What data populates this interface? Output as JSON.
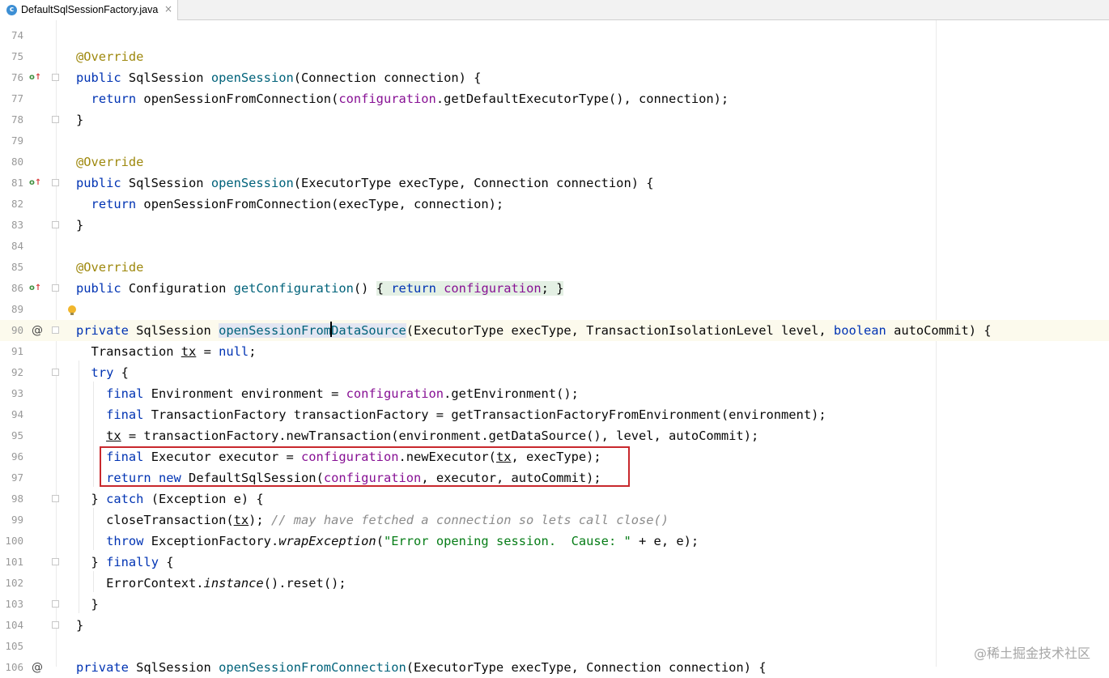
{
  "tab": {
    "icon_letter": "c",
    "title": "DefaultSqlSessionFactory.java",
    "close": "×"
  },
  "gutter": {
    "line_numbers": [
      "74",
      "75",
      "76",
      "77",
      "78",
      "79",
      "80",
      "81",
      "82",
      "83",
      "84",
      "85",
      "86",
      "89",
      "90",
      "91",
      "92",
      "93",
      "94",
      "95",
      "96",
      "97",
      "98",
      "99",
      "100",
      "101",
      "102",
      "103",
      "104",
      "105",
      "106"
    ],
    "override_icon": "o",
    "up_arrow": "↑",
    "at_marker": "@"
  },
  "code": {
    "l75": "@Override",
    "l76": {
      "t1": "public",
      "t2": " SqlSession ",
      "t3": "openSession",
      "t4": "(Connection connection) {"
    },
    "l77": {
      "t1": "return",
      "t2": " openSessionFromConnection(",
      "t3": "configuration",
      "t4": ".getDefaultExecutorType(), connection);"
    },
    "l78": "}",
    "l80": "@Override",
    "l81": {
      "t1": "public",
      "t2": " SqlSession ",
      "t3": "openSession",
      "t4": "(ExecutorType execType, Connection connection) {"
    },
    "l82": {
      "t1": "return",
      "t2": " openSessionFromConnection(execType, connection);"
    },
    "l83": "}",
    "l85": "@Override",
    "l86": {
      "t1": "public",
      "t2": " Configuration ",
      "t3": "getConfiguration",
      "t4": "() ",
      "t5": "{",
      "t6": "return",
      "t7": "configuration",
      "t8": ";",
      "t9": "}"
    },
    "l90": {
      "t1": "private",
      "t2": " SqlSession ",
      "t3a": "openSessionFrom",
      "t3b": "DataSource",
      "t4": "(ExecutorType execType, TransactionIsolationLevel level, ",
      "t5": "boolean",
      "t6": " autoCommit) {"
    },
    "l91": {
      "t1": "Transaction ",
      "t2": "tx",
      "t3": " = ",
      "t4": "null",
      "t5": ";"
    },
    "l92": {
      "t1": "try",
      "t2": " {"
    },
    "l93": {
      "t1": "final",
      "t2": " Environment environment = ",
      "t3": "configuration",
      "t4": ".getEnvironment();"
    },
    "l94": {
      "t1": "final",
      "t2": " TransactionFactory transactionFactory = getTransactionFactoryFromEnvironment(environment);"
    },
    "l95": {
      "t1": "tx",
      "t2": " = transactionFactory.newTransaction(environment.getDataSource(), level, autoCommit);"
    },
    "l96": {
      "t1": "final",
      "t2": " Executor executor = ",
      "t3": "configuration",
      "t4": ".newExecutor(",
      "t5": "tx",
      "t6": ", execType);"
    },
    "l97": {
      "t1": "return",
      "t2": " ",
      "t3": "new",
      "t4": " DefaultSqlSession(",
      "t5": "configuration",
      "t6": ", executor, autoCommit);"
    },
    "l98": {
      "t1": "} ",
      "t2": "catch",
      "t3": " (Exception e) {"
    },
    "l99": {
      "t1": "closeTransaction(",
      "t2": "tx",
      "t3": "); ",
      "t4": "// may have fetched a connection so lets call close()"
    },
    "l100": {
      "t1": "throw",
      "t2": " ExceptionFactory.",
      "t3": "wrapException",
      "t4": "(",
      "t5": "\"Error opening session.  Cause: \"",
      "t6": " + e, e);"
    },
    "l101": {
      "t1": "} ",
      "t2": "finally",
      "t3": " {"
    },
    "l102": {
      "t1": "ErrorContext.",
      "t2": "instance",
      "t3": "().reset();"
    },
    "l103": "}",
    "l104": "}",
    "l106": {
      "t1": "private",
      "t2": " SqlSession ",
      "t3": "openSessionFromConnection",
      "t4": "(ExecutorType execType, Connection connection) {"
    }
  },
  "watermark": "@稀土掘金技术社区",
  "colors": {
    "keyword": "#0033b3",
    "annotation": "#9e880d",
    "method": "#00627a",
    "field": "#871094",
    "string": "#067d17",
    "highlight_box": "#c8282d"
  }
}
